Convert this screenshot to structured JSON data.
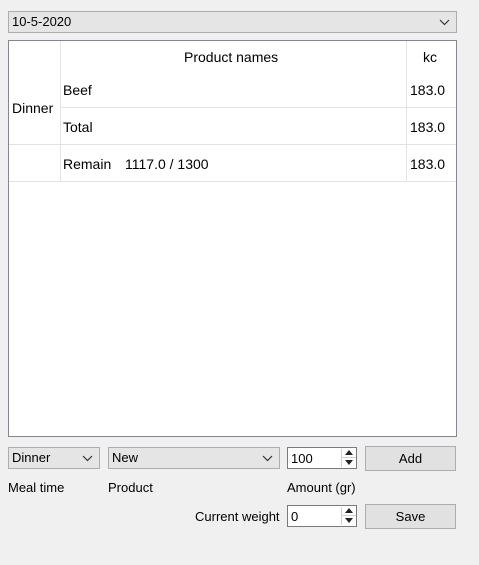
{
  "date_select": {
    "value": "10-5-2020"
  },
  "table": {
    "headers": {
      "product": "Product names",
      "kc": "kc"
    },
    "meal_label": "Dinner",
    "rows": [
      {
        "product": "Beef",
        "kc": "183.0"
      },
      {
        "product": "Total",
        "kc": "183.0"
      }
    ],
    "remain": {
      "label": "Remain",
      "value": "1117.0 / 1300",
      "kc": "183.0"
    }
  },
  "controls": {
    "meal_select": "Dinner",
    "product_select": "New",
    "amount_value": "100",
    "add_label": "Add",
    "weight_value": "0",
    "save_label": "Save"
  },
  "labels": {
    "meal_time": "Meal time",
    "product": "Product",
    "amount": "Amount (gr)",
    "current_weight": "Current weight"
  },
  "icons": {
    "dropdown": "chevron-down-icon",
    "spin_up": "up-arrow-icon",
    "spin_down": "down-arrow-icon"
  }
}
